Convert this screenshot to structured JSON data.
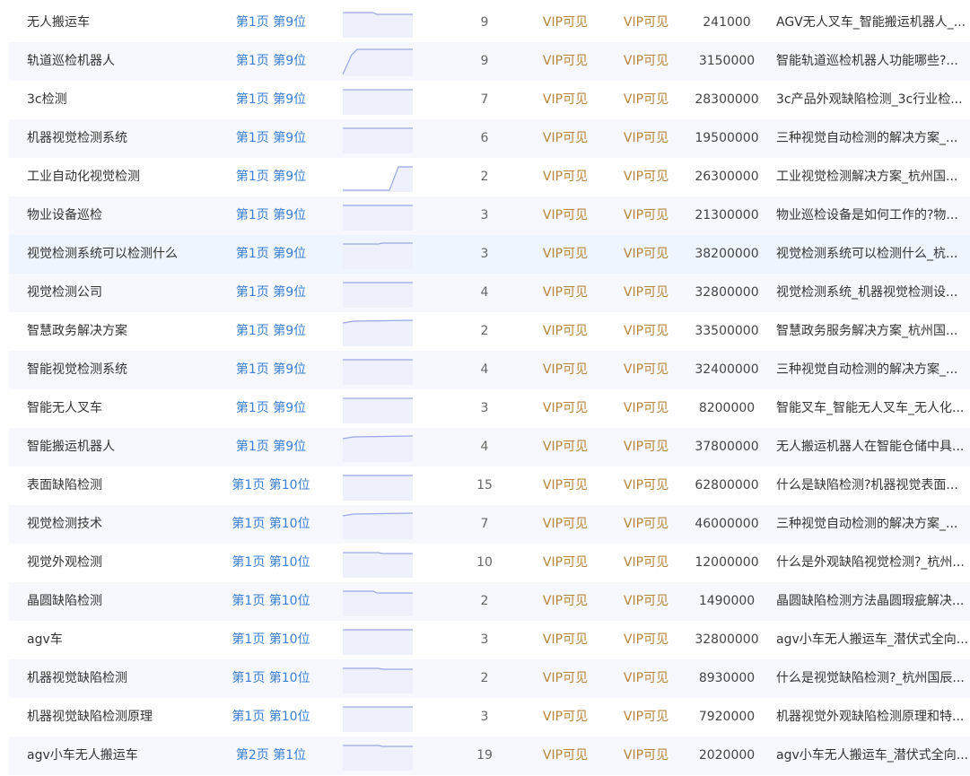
{
  "colors": {
    "rank_link": "#3a7fd5",
    "vip_text": "#b7853d",
    "spark_line": "#9aa7e6",
    "spark_fill": "#eef0fb",
    "row_alt_bg": "#f7f8fd",
    "row_hover_bg": "#eef5fe"
  },
  "rows": [
    {
      "keyword": "无人搬运车",
      "rank": "第1页 第9位",
      "trend": "drop-small",
      "count": "9",
      "vip1": "VIP可见",
      "vip2": "VIP可见",
      "index": "241000",
      "title": "AGV无人叉车_智能搬运机器人_..."
    },
    {
      "keyword": "轨道巡检机器人",
      "rank": "第1页 第9位",
      "trend": "rise-early",
      "count": "9",
      "vip1": "VIP可见",
      "vip2": "VIP可见",
      "index": "3150000",
      "title": "智能轨道巡检机器人功能哪些?..."
    },
    {
      "keyword": "3c检测",
      "rank": "第1页 第9位",
      "trend": "flat",
      "count": "7",
      "vip1": "VIP可见",
      "vip2": "VIP可见",
      "index": "28300000",
      "title": "3c产品外观缺陷检测_3c行业检..."
    },
    {
      "keyword": "机器视觉检测系统",
      "rank": "第1页 第9位",
      "trend": "flat",
      "count": "6",
      "vip1": "VIP可见",
      "vip2": "VIP可见",
      "index": "19500000",
      "title": "三种视觉自动检测的解决方案_..."
    },
    {
      "keyword": "工业自动化视觉检测",
      "rank": "第1页 第9位",
      "trend": "rise-late",
      "count": "2",
      "vip1": "VIP可见",
      "vip2": "VIP可见",
      "index": "26300000",
      "title": "工业视觉检测解决方案_杭州国..."
    },
    {
      "keyword": "物业设备巡检",
      "rank": "第1页 第9位",
      "trend": "flat",
      "count": "3",
      "vip1": "VIP可见",
      "vip2": "VIP可见",
      "index": "21300000",
      "title": "物业巡检设备是如何工作的?物..."
    },
    {
      "keyword": "视觉检测系统可以检测什么",
      "rank": "第1页 第9位",
      "trend": "flat-high",
      "count": "3",
      "vip1": "VIP可见",
      "vip2": "VIP可见",
      "index": "38200000",
      "title": "视觉检测系统可以检测什么_杭..."
    },
    {
      "keyword": "视觉检测公司",
      "rank": "第1页 第9位",
      "trend": "flat",
      "count": "4",
      "vip1": "VIP可见",
      "vip2": "VIP可见",
      "index": "32800000",
      "title": "视觉检测系统_机器视觉检测设..."
    },
    {
      "keyword": "智慧政务解决方案",
      "rank": "第1页 第9位",
      "trend": "rise-small",
      "count": "2",
      "vip1": "VIP可见",
      "vip2": "VIP可见",
      "index": "33500000",
      "title": "智慧政务服务解决方案_杭州国..."
    },
    {
      "keyword": "智能视觉检测系统",
      "rank": "第1页 第9位",
      "trend": "flat",
      "count": "4",
      "vip1": "VIP可见",
      "vip2": "VIP可见",
      "index": "32400000",
      "title": "三种视觉自动检测的解决方案_..."
    },
    {
      "keyword": "智能无人叉车",
      "rank": "第1页 第9位",
      "trend": "flat",
      "count": "3",
      "vip1": "VIP可见",
      "vip2": "VIP可见",
      "index": "8200000",
      "title": "智能叉车_智能无人叉车_无人化..."
    },
    {
      "keyword": "智能搬运机器人",
      "rank": "第1页 第9位",
      "trend": "rise-small",
      "count": "4",
      "vip1": "VIP可见",
      "vip2": "VIP可见",
      "index": "37800000",
      "title": "无人搬运机器人在智能仓储中具..."
    },
    {
      "keyword": "表面缺陷检测",
      "rank": "第1页 第10位",
      "trend": "flat",
      "count": "15",
      "vip1": "VIP可见",
      "vip2": "VIP可见",
      "index": "62800000",
      "title": "什么是缺陷检测?机器视觉表面..."
    },
    {
      "keyword": "视觉检测技术",
      "rank": "第1页 第10位",
      "trend": "rise-small",
      "count": "7",
      "vip1": "VIP可见",
      "vip2": "VIP可见",
      "index": "46000000",
      "title": "三种视觉自动检测的解决方案_..."
    },
    {
      "keyword": "视觉外观检测",
      "rank": "第1页 第10位",
      "trend": "drop-tiny",
      "count": "10",
      "vip1": "VIP可见",
      "vip2": "VIP可见",
      "index": "12000000",
      "title": "什么是外观缺陷视觉检测?_杭州..."
    },
    {
      "keyword": "晶圆缺陷检测",
      "rank": "第1页 第10位",
      "trend": "drop-small",
      "count": "2",
      "vip1": "VIP可见",
      "vip2": "VIP可见",
      "index": "1490000",
      "title": "晶圆缺陷检测方法晶圆瑕疵解决..."
    },
    {
      "keyword": "agv车",
      "rank": "第1页 第10位",
      "trend": "flat",
      "count": "3",
      "vip1": "VIP可见",
      "vip2": "VIP可见",
      "index": "32800000",
      "title": "agv小车无人搬运车_潜伏式全向..."
    },
    {
      "keyword": "机器视觉缺陷检测",
      "rank": "第1页 第10位",
      "trend": "drop-tiny",
      "count": "2",
      "vip1": "VIP可见",
      "vip2": "VIP可见",
      "index": "8930000",
      "title": "什么是视觉缺陷检测?_杭州国辰..."
    },
    {
      "keyword": "机器视觉缺陷检测原理",
      "rank": "第1页 第10位",
      "trend": "flat",
      "count": "3",
      "vip1": "VIP可见",
      "vip2": "VIP可见",
      "index": "7920000",
      "title": "机器视觉外观缺陷检测原理和特..."
    },
    {
      "keyword": "agv小车无人搬运车",
      "rank": "第2页 第1位",
      "trend": "drop-tiny",
      "count": "19",
      "vip1": "VIP可见",
      "vip2": "VIP可见",
      "index": "2020000",
      "title": "agv小车无人搬运车_潜伏式全向..."
    }
  ]
}
